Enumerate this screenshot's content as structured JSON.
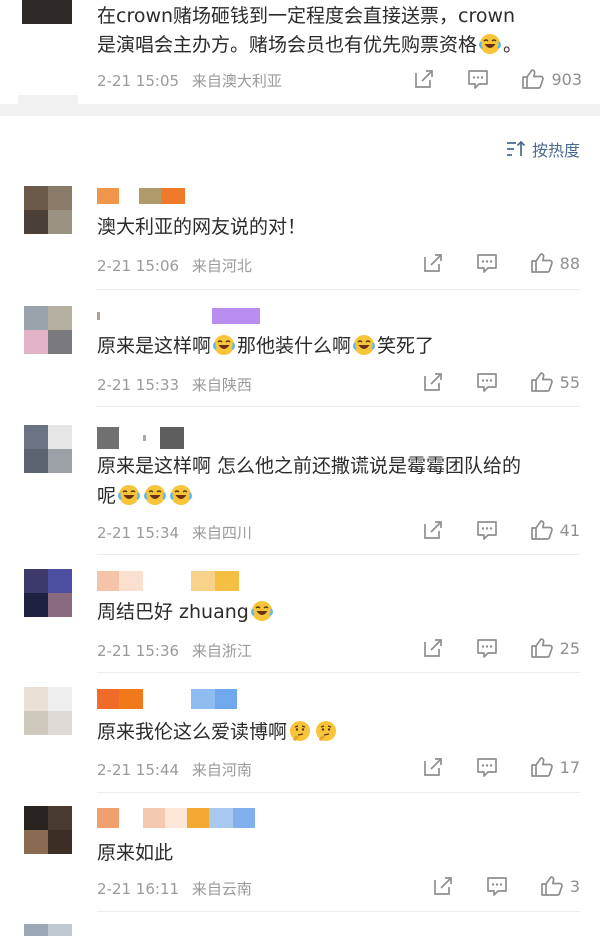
{
  "top_comment": {
    "text_line1": "在crown赌场砸钱到一定程度会直接送票，crown",
    "text_line2": "是演唱会主办方。赌场会员也有优先购票资格",
    "text_end": "。",
    "time": "2-21 15:05",
    "location": "来自澳大利亚",
    "likes": "903"
  },
  "sort": {
    "label": "按热度"
  },
  "comments": [
    {
      "text": "澳大利亚的网友说的对！",
      "time": "2-21 15:06",
      "location": "来自河北",
      "likes": "88"
    },
    {
      "text_a": "原来是这样啊",
      "text_b": "那他装什么啊",
      "text_c": "笑死了",
      "time": "2-21 15:33",
      "location": "来自陕西",
      "likes": "55"
    },
    {
      "text_line1": "原来是这样啊 怎么他之前还撒谎说是霉霉团队给的",
      "text_line2": "呢",
      "time": "2-21 15:34",
      "location": "来自四川",
      "likes": "41"
    },
    {
      "text": "周结巴好 zhuang",
      "time": "2-21 15:36",
      "location": "来自浙江",
      "likes": "25"
    },
    {
      "text": "原来我伦这么爱读博啊",
      "time": "2-21 15:44",
      "location": "来自河南",
      "likes": "17"
    },
    {
      "text": "原来如此",
      "time": "2-21 16:11",
      "location": "来自云南",
      "likes": "3"
    }
  ],
  "colors": {
    "link": "#4a6a90",
    "meta": "#9a9a9a",
    "text": "#2b2b2b"
  },
  "icons": {
    "share": "share-icon",
    "reply": "reply-icon",
    "like": "thumbs-up-icon",
    "sort": "sort-icon",
    "laugh": "laugh-cry-emoji",
    "think": "thinking-emoji"
  }
}
